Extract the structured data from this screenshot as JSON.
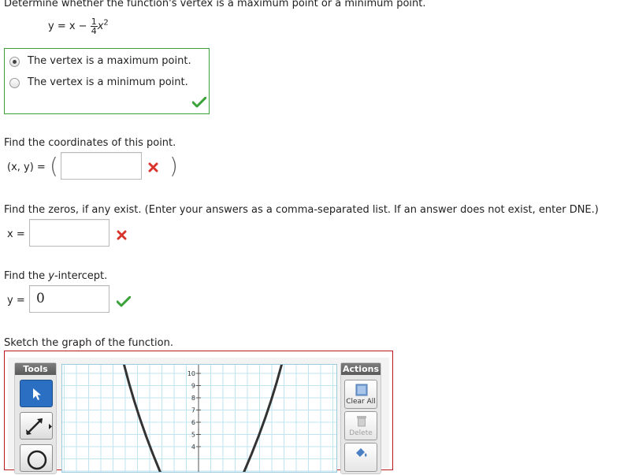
{
  "question1": {
    "prompt": "Determine whether the function's vertex is a maximum point or a minimum point.",
    "equation": {
      "lhs": "y = x −",
      "frac_num": "1",
      "frac_den": "4",
      "var": "x",
      "exp": "2"
    },
    "options": [
      {
        "label": "The vertex is a maximum point.",
        "selected": true
      },
      {
        "label": "The vertex is a minimum point.",
        "selected": false
      }
    ],
    "status_icon": "check-icon"
  },
  "question2": {
    "prompt": "Find the coordinates of this point.",
    "label": "(x, y) =",
    "open_paren": "(",
    "close_paren": ")",
    "value": "",
    "status_icon": "cross-icon"
  },
  "question3": {
    "prompt": "Find the zeros, if any exist. (Enter your answers as a comma-separated list. If an answer does not exist, enter DNE.)",
    "label": "x =",
    "value": "",
    "status_icon": "cross-icon"
  },
  "question4": {
    "prompt_pre": "Find the ",
    "prompt_var": "y",
    "prompt_post": "-intercept.",
    "label": "y =",
    "value": "0",
    "status_icon": "check-icon"
  },
  "question5": {
    "prompt": "Sketch the graph of the function.",
    "tools_title": "Tools",
    "actions_title": "Actions",
    "tools": [
      "arrow-pointer-icon",
      "line-tool-icon",
      "circle-tool-icon"
    ],
    "actions": [
      {
        "label": "Clear All",
        "icon": "clear-all-icon",
        "enabled": true
      },
      {
        "label": "Delete",
        "icon": "trash-icon",
        "enabled": false
      },
      {
        "label": "",
        "icon": "fill-icon",
        "enabled": true
      }
    ],
    "y_ticks": [
      "10",
      "9",
      "8",
      "7",
      "6",
      "5",
      "4"
    ]
  },
  "colors": {
    "correct": "#39a339",
    "incorrect": "#d9342b",
    "graph_border": "#b81c1c",
    "active_tool": "#2a6fc1",
    "grid": "#bfe4f2"
  }
}
